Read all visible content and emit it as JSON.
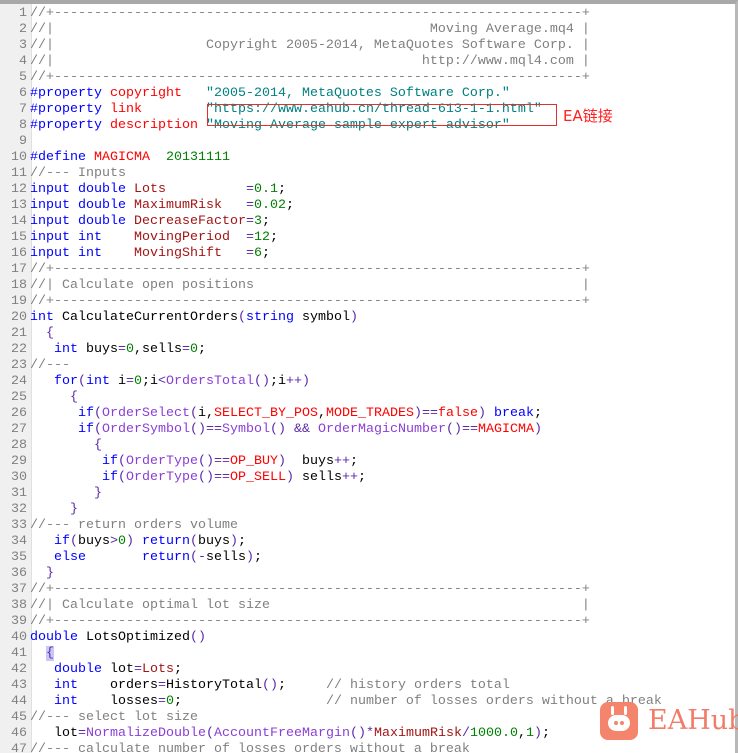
{
  "lines": [
    {
      "n": "1",
      "tokens": [
        [
          "c",
          "//+------------------------------------------------------------------+"
        ]
      ]
    },
    {
      "n": "2",
      "tokens": [
        [
          "c",
          "//|                                               Moving Average.mq4 |"
        ]
      ]
    },
    {
      "n": "3",
      "tokens": [
        [
          "c",
          "//|                   Copyright 2005-2014, MetaQuotes Software Corp. |"
        ]
      ]
    },
    {
      "n": "4",
      "tokens": [
        [
          "c",
          "//|                                              http://www.mql4.com |"
        ]
      ]
    },
    {
      "n": "5",
      "tokens": [
        [
          "c",
          "//+------------------------------------------------------------------+"
        ]
      ]
    },
    {
      "n": "6",
      "tokens": [
        [
          "k",
          "#property"
        ],
        [
          "t",
          " "
        ],
        [
          "r",
          "copyright"
        ],
        [
          "t",
          "   "
        ],
        [
          "s",
          "\"2005-2014, MetaQuotes Software Corp.\""
        ]
      ]
    },
    {
      "n": "7",
      "tokens": [
        [
          "k",
          "#property"
        ],
        [
          "t",
          " "
        ],
        [
          "r",
          "link"
        ],
        [
          "t",
          "        "
        ],
        [
          "s",
          "\"https://www.eahub.cn/thread-613-1-1.html\""
        ]
      ]
    },
    {
      "n": "8",
      "tokens": [
        [
          "k",
          "#property"
        ],
        [
          "t",
          " "
        ],
        [
          "r",
          "description"
        ],
        [
          "t",
          " "
        ],
        [
          "s",
          "\"Moving Average sample expert advisor\""
        ]
      ]
    },
    {
      "n": "9",
      "tokens": []
    },
    {
      "n": "10",
      "tokens": [
        [
          "k",
          "#define"
        ],
        [
          "t",
          " "
        ],
        [
          "r",
          "MAGICMA"
        ],
        [
          "t",
          "  "
        ],
        [
          "n",
          "20131111"
        ]
      ]
    },
    {
      "n": "11",
      "tokens": [
        [
          "c",
          "//--- Inputs"
        ]
      ]
    },
    {
      "n": "12",
      "tokens": [
        [
          "k",
          "input"
        ],
        [
          "t",
          " "
        ],
        [
          "k",
          "double"
        ],
        [
          "t",
          " "
        ],
        [
          "v",
          "Lots"
        ],
        [
          "t",
          "          "
        ],
        [
          "o",
          "="
        ],
        [
          "n",
          "0.1"
        ],
        [
          "t",
          ";"
        ]
      ]
    },
    {
      "n": "13",
      "tokens": [
        [
          "k",
          "input"
        ],
        [
          "t",
          " "
        ],
        [
          "k",
          "double"
        ],
        [
          "t",
          " "
        ],
        [
          "v",
          "MaximumRisk"
        ],
        [
          "t",
          "   "
        ],
        [
          "o",
          "="
        ],
        [
          "n",
          "0.02"
        ],
        [
          "t",
          ";"
        ]
      ]
    },
    {
      "n": "14",
      "tokens": [
        [
          "k",
          "input"
        ],
        [
          "t",
          " "
        ],
        [
          "k",
          "double"
        ],
        [
          "t",
          " "
        ],
        [
          "v",
          "DecreaseFactor"
        ],
        [
          "o",
          "="
        ],
        [
          "n",
          "3"
        ],
        [
          "t",
          ";"
        ]
      ]
    },
    {
      "n": "15",
      "tokens": [
        [
          "k",
          "input"
        ],
        [
          "t",
          " "
        ],
        [
          "k",
          "int"
        ],
        [
          "t",
          "    "
        ],
        [
          "v",
          "MovingPeriod"
        ],
        [
          "t",
          "  "
        ],
        [
          "o",
          "="
        ],
        [
          "n",
          "12"
        ],
        [
          "t",
          ";"
        ]
      ]
    },
    {
      "n": "16",
      "tokens": [
        [
          "k",
          "input"
        ],
        [
          "t",
          " "
        ],
        [
          "k",
          "int"
        ],
        [
          "t",
          "    "
        ],
        [
          "v",
          "MovingShift"
        ],
        [
          "t",
          "   "
        ],
        [
          "o",
          "="
        ],
        [
          "n",
          "6"
        ],
        [
          "t",
          ";"
        ]
      ]
    },
    {
      "n": "17",
      "tokens": [
        [
          "c",
          "//+------------------------------------------------------------------+"
        ]
      ]
    },
    {
      "n": "18",
      "tokens": [
        [
          "c",
          "//| Calculate open positions                                         |"
        ]
      ]
    },
    {
      "n": "19",
      "tokens": [
        [
          "c",
          "//+------------------------------------------------------------------+"
        ]
      ]
    },
    {
      "n": "20",
      "tokens": [
        [
          "k",
          "int"
        ],
        [
          "t",
          " CalculateCurrentOrders"
        ],
        [
          "o",
          "("
        ],
        [
          "k",
          "string"
        ],
        [
          "t",
          " symbol"
        ],
        [
          "o",
          ")"
        ]
      ]
    },
    {
      "n": "21",
      "tokens": [
        [
          "t",
          "  "
        ],
        [
          "o",
          "{"
        ]
      ]
    },
    {
      "n": "22",
      "tokens": [
        [
          "t",
          "   "
        ],
        [
          "k",
          "int"
        ],
        [
          "t",
          " buys"
        ],
        [
          "o",
          "="
        ],
        [
          "n",
          "0"
        ],
        [
          "t",
          ",sells"
        ],
        [
          "o",
          "="
        ],
        [
          "n",
          "0"
        ],
        [
          "t",
          ";"
        ]
      ]
    },
    {
      "n": "23",
      "tokens": [
        [
          "c",
          "//---"
        ]
      ]
    },
    {
      "n": "24",
      "tokens": [
        [
          "t",
          "   "
        ],
        [
          "k",
          "for"
        ],
        [
          "o",
          "("
        ],
        [
          "k",
          "int"
        ],
        [
          "t",
          " i"
        ],
        [
          "o",
          "="
        ],
        [
          "n",
          "0"
        ],
        [
          "t",
          ";i"
        ],
        [
          "o",
          "<"
        ],
        [
          "f",
          "OrdersTotal"
        ],
        [
          "o",
          "()"
        ],
        [
          "t",
          ";i"
        ],
        [
          "o",
          "++)"
        ]
      ]
    },
    {
      "n": "25",
      "tokens": [
        [
          "t",
          "     "
        ],
        [
          "o",
          "{"
        ]
      ]
    },
    {
      "n": "26",
      "tokens": [
        [
          "t",
          "      "
        ],
        [
          "k",
          "if"
        ],
        [
          "o",
          "("
        ],
        [
          "f",
          "OrderSelect"
        ],
        [
          "o",
          "("
        ],
        [
          "t",
          "i,"
        ],
        [
          "r",
          "SELECT_BY_POS"
        ],
        [
          "t",
          ","
        ],
        [
          "r",
          "MODE_TRADES"
        ],
        [
          "o",
          ")=="
        ],
        [
          "r",
          "false"
        ],
        [
          "o",
          ")"
        ],
        [
          "t",
          " "
        ],
        [
          "k",
          "break"
        ],
        [
          "t",
          ";"
        ]
      ]
    },
    {
      "n": "27",
      "tokens": [
        [
          "t",
          "      "
        ],
        [
          "k",
          "if"
        ],
        [
          "o",
          "("
        ],
        [
          "f",
          "OrderSymbol"
        ],
        [
          "o",
          "()=="
        ],
        [
          "f",
          "Symbol"
        ],
        [
          "o",
          "()"
        ],
        [
          "t",
          " "
        ],
        [
          "o",
          "&&"
        ],
        [
          "t",
          " "
        ],
        [
          "f",
          "OrderMagicNumber"
        ],
        [
          "o",
          "()=="
        ],
        [
          "r",
          "MAGICMA"
        ],
        [
          "o",
          ")"
        ]
      ]
    },
    {
      "n": "28",
      "tokens": [
        [
          "t",
          "        "
        ],
        [
          "o",
          "{"
        ]
      ]
    },
    {
      "n": "29",
      "tokens": [
        [
          "t",
          "         "
        ],
        [
          "k",
          "if"
        ],
        [
          "o",
          "("
        ],
        [
          "f",
          "OrderType"
        ],
        [
          "o",
          "()=="
        ],
        [
          "r",
          "OP_BUY"
        ],
        [
          "o",
          ")"
        ],
        [
          "t",
          "  buys"
        ],
        [
          "o",
          "++"
        ],
        [
          "t",
          ";"
        ]
      ]
    },
    {
      "n": "30",
      "tokens": [
        [
          "t",
          "         "
        ],
        [
          "k",
          "if"
        ],
        [
          "o",
          "("
        ],
        [
          "f",
          "OrderType"
        ],
        [
          "o",
          "()=="
        ],
        [
          "r",
          "OP_SELL"
        ],
        [
          "o",
          ")"
        ],
        [
          "t",
          " sells"
        ],
        [
          "o",
          "++"
        ],
        [
          "t",
          ";"
        ]
      ]
    },
    {
      "n": "31",
      "tokens": [
        [
          "t",
          "        "
        ],
        [
          "o",
          "}"
        ]
      ]
    },
    {
      "n": "32",
      "tokens": [
        [
          "t",
          "     "
        ],
        [
          "o",
          "}"
        ]
      ]
    },
    {
      "n": "33",
      "tokens": [
        [
          "c",
          "//--- return orders volume"
        ]
      ]
    },
    {
      "n": "34",
      "tokens": [
        [
          "t",
          "   "
        ],
        [
          "k",
          "if"
        ],
        [
          "o",
          "("
        ],
        [
          "t",
          "buys"
        ],
        [
          "o",
          ">"
        ],
        [
          "n",
          "0"
        ],
        [
          "o",
          ")"
        ],
        [
          "t",
          " "
        ],
        [
          "k",
          "return"
        ],
        [
          "o",
          "("
        ],
        [
          "t",
          "buys"
        ],
        [
          "o",
          ")"
        ],
        [
          "t",
          ";"
        ]
      ]
    },
    {
      "n": "35",
      "tokens": [
        [
          "t",
          "   "
        ],
        [
          "k",
          "else"
        ],
        [
          "t",
          "       "
        ],
        [
          "k",
          "return"
        ],
        [
          "o",
          "(-"
        ],
        [
          "t",
          "sells"
        ],
        [
          "o",
          ")"
        ],
        [
          "t",
          ";"
        ]
      ]
    },
    {
      "n": "36",
      "tokens": [
        [
          "t",
          "  "
        ],
        [
          "o",
          "}"
        ]
      ]
    },
    {
      "n": "37",
      "tokens": [
        [
          "c",
          "//+------------------------------------------------------------------+"
        ]
      ]
    },
    {
      "n": "38",
      "tokens": [
        [
          "c",
          "//| Calculate optimal lot size                                       |"
        ]
      ]
    },
    {
      "n": "39",
      "tokens": [
        [
          "c",
          "//+------------------------------------------------------------------+"
        ]
      ]
    },
    {
      "n": "40",
      "tokens": [
        [
          "k",
          "double"
        ],
        [
          "t",
          " LotsOptimized"
        ],
        [
          "o",
          "()"
        ]
      ]
    },
    {
      "n": "41",
      "tokens": [
        [
          "t",
          "  "
        ],
        [
          "hl",
          "{"
        ]
      ]
    },
    {
      "n": "42",
      "tokens": [
        [
          "t",
          "   "
        ],
        [
          "k",
          "double"
        ],
        [
          "t",
          " lot"
        ],
        [
          "o",
          "="
        ],
        [
          "v",
          "Lots"
        ],
        [
          "t",
          ";"
        ]
      ]
    },
    {
      "n": "43",
      "tokens": [
        [
          "t",
          "   "
        ],
        [
          "k",
          "int"
        ],
        [
          "t",
          "    orders"
        ],
        [
          "o",
          "="
        ],
        [
          "t",
          "HistoryTotal"
        ],
        [
          "o",
          "()"
        ],
        [
          "t",
          ";     "
        ],
        [
          "c",
          "// history orders total"
        ]
      ]
    },
    {
      "n": "44",
      "tokens": [
        [
          "t",
          "   "
        ],
        [
          "k",
          "int"
        ],
        [
          "t",
          "    losses"
        ],
        [
          "o",
          "="
        ],
        [
          "n",
          "0"
        ],
        [
          "t",
          ";                  "
        ],
        [
          "c",
          "// number of losses orders without a break"
        ]
      ]
    },
    {
      "n": "45",
      "tokens": [
        [
          "c",
          "//--- select lot size"
        ]
      ]
    },
    {
      "n": "46",
      "tokens": [
        [
          "t",
          "   lot"
        ],
        [
          "o",
          "="
        ],
        [
          "f",
          "NormalizeDouble"
        ],
        [
          "o",
          "("
        ],
        [
          "f",
          "AccountFreeMargin"
        ],
        [
          "o",
          "()*"
        ],
        [
          "v",
          "MaximumRisk"
        ],
        [
          "o",
          "/"
        ],
        [
          "n",
          "1000.0"
        ],
        [
          "t",
          ","
        ],
        [
          "n",
          "1"
        ],
        [
          "o",
          ")"
        ],
        [
          "t",
          ";"
        ]
      ]
    },
    {
      "n": "47",
      "tokens": [
        [
          "c",
          "//--- calculate number of losses orders without a break"
        ]
      ]
    }
  ],
  "annotation": {
    "label": "EA链接",
    "color": "#ff2020"
  },
  "watermark": {
    "text": "EAHub",
    "color": "#f4846c"
  }
}
